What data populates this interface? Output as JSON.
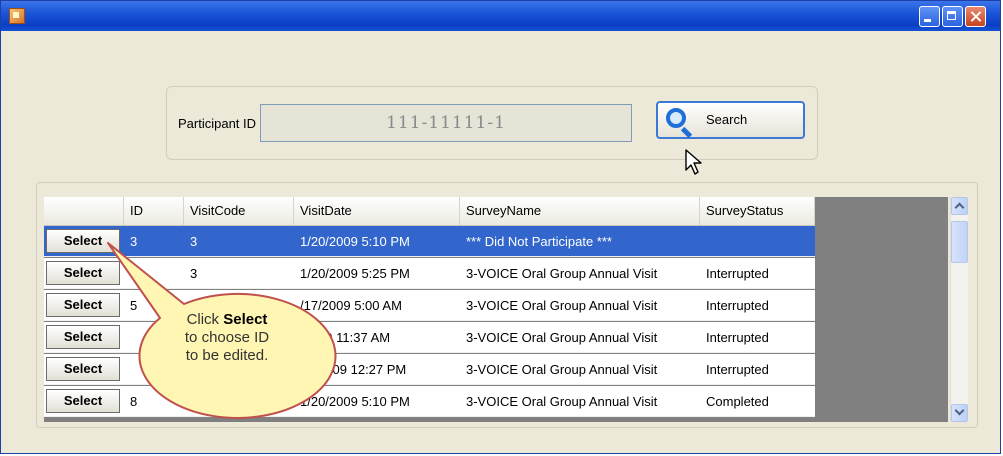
{
  "search": {
    "label": "Participant ID",
    "value": "111-11111-1",
    "button_label": "Search"
  },
  "grid": {
    "columns": [
      "",
      "ID",
      "VisitCode",
      "VisitDate",
      "SurveyName",
      "SurveyStatus"
    ],
    "select_label": "Select",
    "rows": [
      {
        "id": "3",
        "visit_code": "3",
        "visit_date": "1/20/2009 5:10 PM",
        "survey_name": "*** Did Not Participate ***",
        "survey_status": ""
      },
      {
        "id": "",
        "visit_code": "3",
        "visit_date": "1/20/2009 5:25 PM",
        "survey_name": "3-VOICE Oral Group Annual Visit",
        "survey_status": "Interrupted"
      },
      {
        "id": "5",
        "visit_code": "",
        "visit_date": "/17/2009 5:00 AM",
        "survey_name": "3-VOICE Oral Group Annual Visit",
        "survey_status": "Interrupted"
      },
      {
        "id": "",
        "visit_code": "",
        "visit_date": "/2009 11:37 AM",
        "survey_name": "3-VOICE Oral Group Annual Visit",
        "survey_status": "Interrupted"
      },
      {
        "id": "",
        "visit_code": "",
        "visit_date": "21/2009 12:27 PM",
        "survey_name": "3-VOICE Oral Group Annual Visit",
        "survey_status": "Interrupted"
      },
      {
        "id": "8",
        "visit_code": "",
        "visit_date": "1/20/2009 5:10 PM",
        "survey_name": "3-VOICE Oral Group Annual Visit",
        "survey_status": "Completed"
      }
    ],
    "selected_row": 0
  },
  "callout": {
    "line1_prefix": "Click ",
    "line1_bold": "Select",
    "line2": "to choose ID",
    "line3": "to be edited."
  },
  "colors": {
    "titlebar": "#1b55d8",
    "selection": "#3366cc",
    "callout_fill": "#fff6b3",
    "callout_border": "#c0504d"
  }
}
